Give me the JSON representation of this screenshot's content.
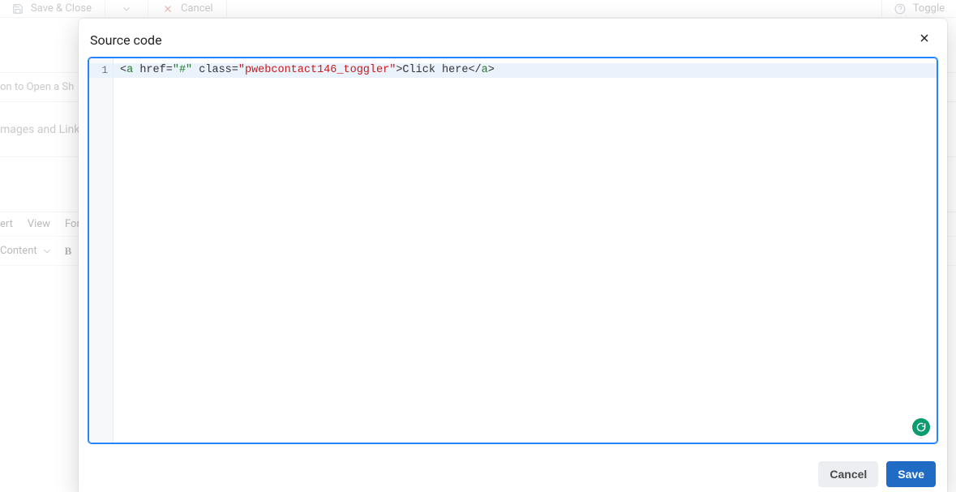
{
  "toolbar": {
    "save_close_label": "Save & Close",
    "cancel_label": "Cancel",
    "toggle_label": "Toggle"
  },
  "backdrop": {
    "strip1_text": "on to Open a Sh",
    "strip2_text": "mages and Link",
    "menu": {
      "item1": "ert",
      "item2": "View",
      "item3": "Form"
    },
    "format": {
      "content_label": "Content",
      "bold_label": "B"
    }
  },
  "modal": {
    "title": "Source code",
    "cancel_label": "Cancel",
    "save_label": "Save",
    "line_number": "1",
    "code": {
      "open_angle": "<",
      "tag_a_open": "a",
      "space1": " ",
      "attr_href": "href=",
      "href_val": "\"#\"",
      "space2": " ",
      "attr_class": "class=",
      "class_val": "\"pwebcontact146_toggler\"",
      "close_angle1": ">",
      "text_content": "Click here",
      "close_open": "</",
      "tag_a_close": "a",
      "close_angle2": ">"
    }
  }
}
